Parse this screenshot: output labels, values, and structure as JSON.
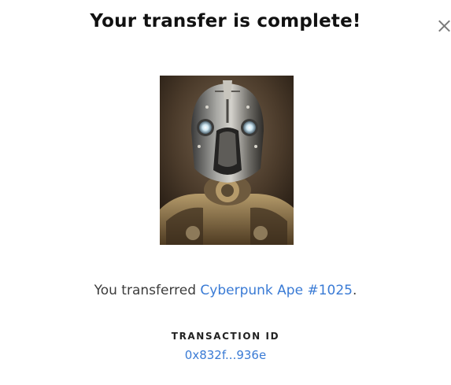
{
  "dialog": {
    "title": "Your transfer is complete!",
    "close_icon": "close-icon"
  },
  "nft": {
    "image_alt": "Cyberpunk Ape #1025 artwork",
    "image_icon": "nft-artwork-image"
  },
  "message": {
    "prefix": "You transferred ",
    "item_name": "Cyberpunk Ape #1025",
    "suffix": "."
  },
  "transaction": {
    "label": "TRANSACTION ID",
    "id_short": "0x832f...936e"
  },
  "colors": {
    "link": "#3a7bd5",
    "title": "#111111",
    "text": "#3c3c3c"
  }
}
